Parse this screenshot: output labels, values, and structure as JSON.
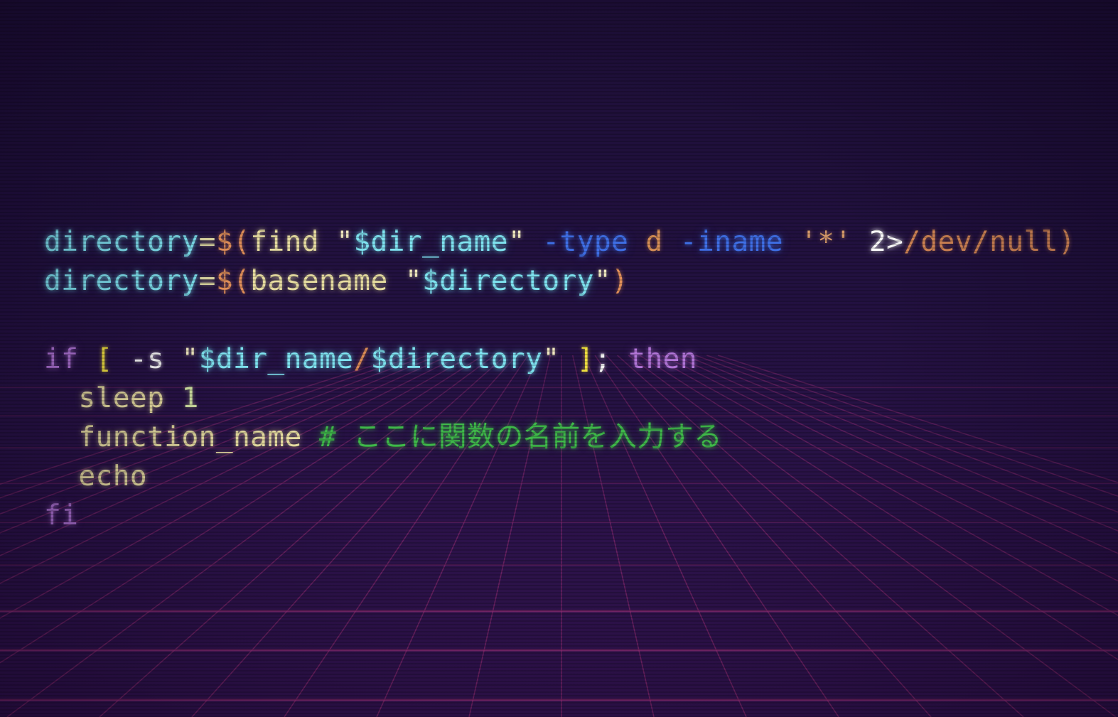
{
  "editor": {
    "language": "bash",
    "theme": "synthwave-grid",
    "lines": [
      [
        {
          "t": "directory",
          "k": "var"
        },
        {
          "t": "=",
          "k": "op"
        },
        {
          "t": "$(",
          "k": "dollar"
        },
        {
          "t": "find",
          "k": "cmd"
        },
        {
          "t": " ",
          "k": "plain"
        },
        {
          "t": "\"",
          "k": "quote"
        },
        {
          "t": "$dir_name",
          "k": "var"
        },
        {
          "t": "\"",
          "k": "quote"
        },
        {
          "t": " ",
          "k": "plain"
        },
        {
          "t": "-type",
          "k": "flag"
        },
        {
          "t": " ",
          "k": "plain"
        },
        {
          "t": "d",
          "k": "arg"
        },
        {
          "t": " ",
          "k": "plain"
        },
        {
          "t": "-iname",
          "k": "flag"
        },
        {
          "t": " ",
          "k": "plain"
        },
        {
          "t": "'*'",
          "k": "glob"
        },
        {
          "t": " ",
          "k": "plain"
        },
        {
          "t": "2>",
          "k": "redir"
        },
        {
          "t": "/dev/null",
          "k": "path"
        },
        {
          "t": ")",
          "k": "dollar"
        }
      ],
      [
        {
          "t": "directory",
          "k": "var"
        },
        {
          "t": "=",
          "k": "op"
        },
        {
          "t": "$(",
          "k": "dollar"
        },
        {
          "t": "basename",
          "k": "cmd"
        },
        {
          "t": " ",
          "k": "plain"
        },
        {
          "t": "\"",
          "k": "quote"
        },
        {
          "t": "$directory",
          "k": "var"
        },
        {
          "t": "\"",
          "k": "quote"
        },
        {
          "t": ")",
          "k": "dollar"
        }
      ],
      [],
      [
        {
          "t": "if",
          "k": "kw"
        },
        {
          "t": " ",
          "k": "plain"
        },
        {
          "t": "[",
          "k": "bracket"
        },
        {
          "t": " ",
          "k": "plain"
        },
        {
          "t": "-s",
          "k": "test"
        },
        {
          "t": " ",
          "k": "plain"
        },
        {
          "t": "\"",
          "k": "quote"
        },
        {
          "t": "$dir_name",
          "k": "var"
        },
        {
          "t": "/",
          "k": "path"
        },
        {
          "t": "$directory",
          "k": "var"
        },
        {
          "t": "\"",
          "k": "quote"
        },
        {
          "t": " ",
          "k": "plain"
        },
        {
          "t": "]",
          "k": "bracket"
        },
        {
          "t": ";",
          "k": "test"
        },
        {
          "t": " ",
          "k": "plain"
        },
        {
          "t": "then",
          "k": "kw"
        }
      ],
      [
        {
          "t": "  ",
          "k": "plain"
        },
        {
          "t": "sleep",
          "k": "cmd"
        },
        {
          "t": " ",
          "k": "plain"
        },
        {
          "t": "1",
          "k": "num"
        }
      ],
      [
        {
          "t": "  ",
          "k": "plain"
        },
        {
          "t": "function_name",
          "k": "cmd"
        },
        {
          "t": " ",
          "k": "plain"
        },
        {
          "t": "# ここに関数の名前を入力する",
          "k": "comment"
        }
      ],
      [
        {
          "t": "  ",
          "k": "plain"
        },
        {
          "t": "echo",
          "k": "cmd"
        }
      ],
      [
        {
          "t": "fi",
          "k": "kw"
        }
      ]
    ]
  },
  "colors": {
    "grid_line": "#a0307a",
    "grid_horizon": "#c03a8c"
  }
}
